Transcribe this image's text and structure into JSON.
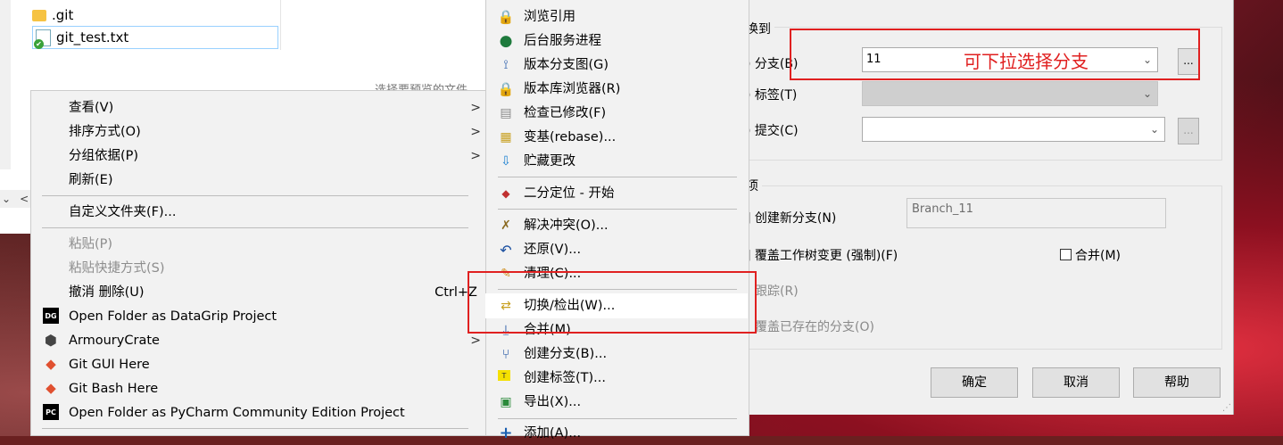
{
  "explorer": {
    "files": [
      {
        "name": ".git",
        "icon": "folder-icon"
      },
      {
        "name": "git_test.txt",
        "icon": "text-file-icon"
      }
    ],
    "preview_hint": "选择要预览的文件",
    "scroll_glyphs": [
      "⌄",
      "<"
    ]
  },
  "context_menu": {
    "items": [
      {
        "label": "查看(V)",
        "submenu": true
      },
      {
        "label": "排序方式(O)",
        "submenu": true
      },
      {
        "label": "分组依据(P)",
        "submenu": true
      },
      {
        "label": "刷新(E)"
      },
      {
        "label": "自定义文件夹(F)..."
      },
      {
        "label": "粘贴(P)",
        "disabled": true
      },
      {
        "label": "粘贴快捷方式(S)",
        "disabled": true
      },
      {
        "label": "撤消 删除(U)",
        "shortcut": "Ctrl+Z"
      },
      {
        "label": "Open Folder as DataGrip Project",
        "icon": "datagrip-icon"
      },
      {
        "label": "ArmouryCrate",
        "icon": "armourycrate-icon",
        "submenu": true
      },
      {
        "label": "Git GUI Here",
        "icon": "git-icon"
      },
      {
        "label": "Git Bash Here",
        "icon": "git-icon"
      },
      {
        "label": "Open Folder as PyCharm Community Edition Project",
        "icon": "pycharm-icon"
      }
    ]
  },
  "tortoise_menu": {
    "items": [
      {
        "label": "浏览引用",
        "icon": "browse-refs-icon"
      },
      {
        "label": "后台服务进程",
        "icon": "daemon-globe-icon"
      },
      {
        "label": "版本分支图(G)",
        "icon": "revision-graph-icon"
      },
      {
        "label": "版本库浏览器(R)",
        "icon": "repo-browser-icon"
      },
      {
        "label": "检查已修改(F)",
        "icon": "check-modifications-icon"
      },
      {
        "label": "变基(rebase)...",
        "icon": "rebase-icon"
      },
      {
        "label": "贮藏更改",
        "icon": "stash-icon"
      },
      {
        "label": "二分定位 - 开始",
        "icon": "bisect-icon"
      },
      {
        "label": "解决冲突(O)...",
        "icon": "resolve-icon"
      },
      {
        "label": "还原(V)...",
        "icon": "revert-icon"
      },
      {
        "label": "清理(C)...",
        "icon": "cleanup-icon"
      },
      {
        "label": "切换/检出(W)...",
        "icon": "switch-checkout-icon"
      },
      {
        "label": "合并(M)...",
        "icon": "merge-icon"
      },
      {
        "label": "创建分支(B)...",
        "icon": "create-branch-icon"
      },
      {
        "label": "创建标签(T)...",
        "icon": "create-tag-icon"
      },
      {
        "label": "导出(X)...",
        "icon": "export-icon"
      },
      {
        "label": "添加(A)...",
        "icon": "add-icon"
      }
    ]
  },
  "dialog": {
    "switch_group_title": "换到",
    "branch_label": "分支(B)",
    "branch_value": "11",
    "tag_label": "标签(T)",
    "commit_label": "提交(C)",
    "browse_button": "...",
    "options_group_title": "项",
    "create_new_branch_label": "创建新分支(N)",
    "new_branch_name": "Branch_11",
    "override_worktree_label": "覆盖工作树变更 (强制)(F)",
    "merge_label": "合并(M)",
    "track_label": "跟踪(R)",
    "override_existing_label": "覆盖已存在的分支(O)",
    "ok_button": "确定",
    "cancel_button": "取消",
    "help_button": "帮助",
    "dropdown_glyph": "⌄",
    "resize_grip": "⋰"
  },
  "annotation": {
    "text": "可下拉选择分支"
  },
  "colors": {
    "annotation_red": "#e02020",
    "menu_bg": "#f2f2f2",
    "dialog_bg": "#f0f0f0"
  }
}
